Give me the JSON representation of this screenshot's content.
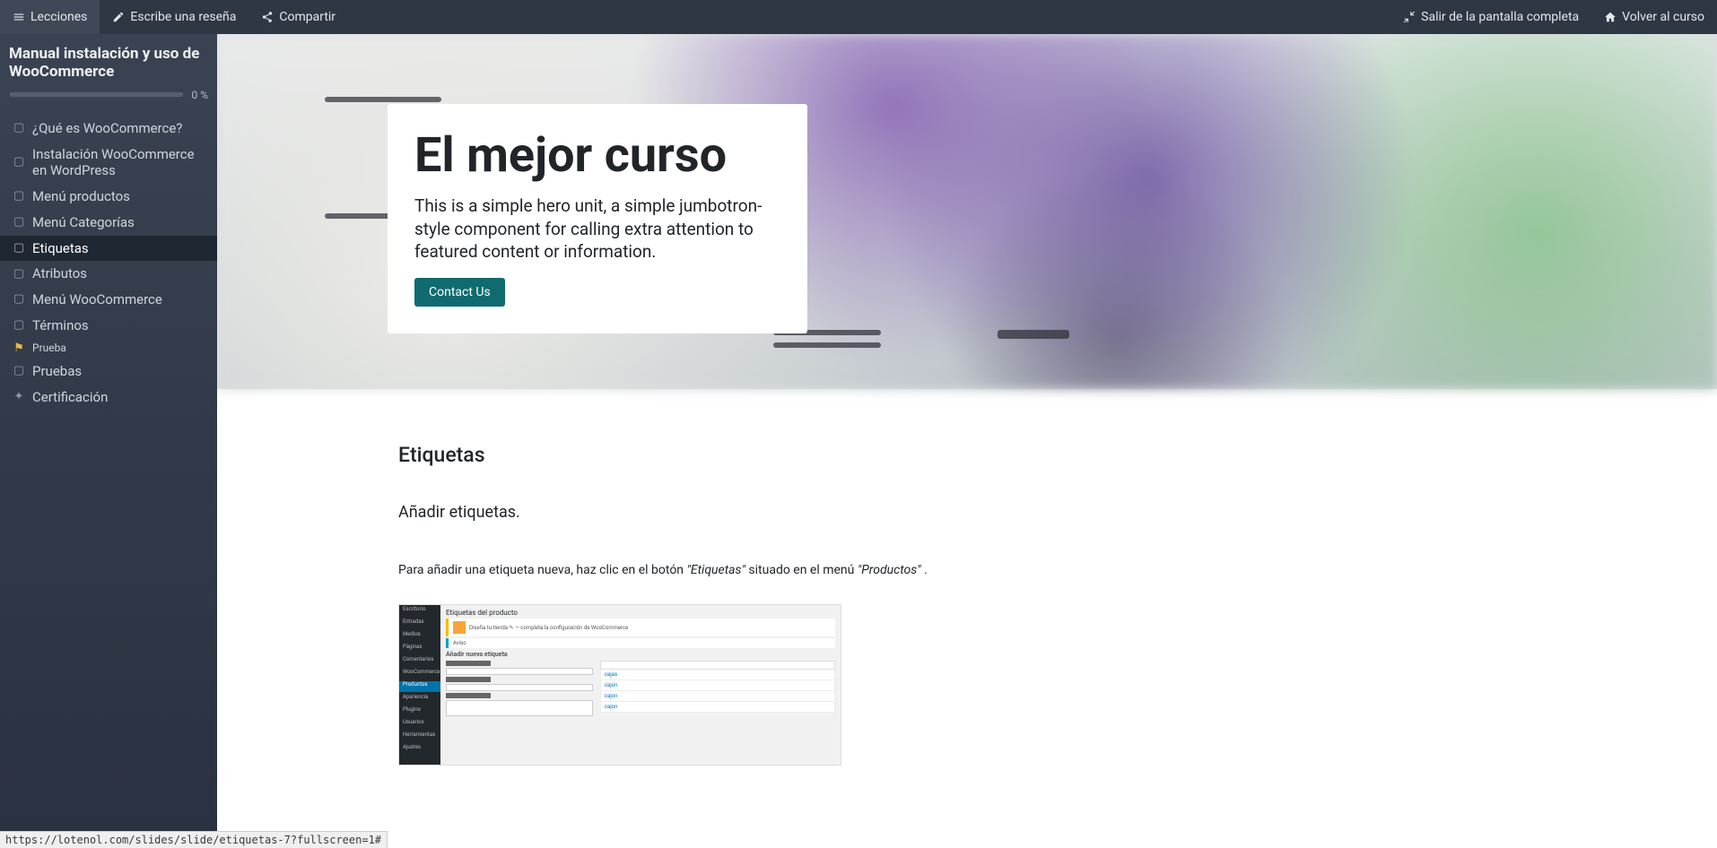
{
  "topnav": {
    "lessons": "Lecciones",
    "review": "Escribe una reseña",
    "share": "Compartir",
    "exit_fullscreen": "Salir de la pantalla completa",
    "back_to_course": "Volver al curso"
  },
  "sidebar": {
    "course_title": "Manual instalación y uso de WooCommerce",
    "progress_pct": "0 %",
    "items": [
      {
        "label": "¿Qué es WooCommerce?",
        "icon": "doc"
      },
      {
        "label": "Instalación WooCommerce en WordPress",
        "icon": "doc"
      },
      {
        "label": "Menú productos",
        "icon": "doc"
      },
      {
        "label": "Menú Categorías",
        "icon": "doc"
      },
      {
        "label": "Etiquetas",
        "icon": "doc",
        "active": true
      },
      {
        "label": "Atributos",
        "icon": "doc"
      },
      {
        "label": "Menú WooCommerce",
        "icon": "doc"
      },
      {
        "label": "Términos",
        "icon": "doc"
      },
      {
        "label": "Prueba",
        "icon": "flag",
        "small": true
      },
      {
        "label": "Pruebas",
        "icon": "doc"
      },
      {
        "label": "Certificación",
        "icon": "cert"
      }
    ]
  },
  "hero": {
    "title": "El mejor curso",
    "text": "This is a simple hero unit, a simple jumbotron-style component for calling extra attention to featured content or information.",
    "cta": "Contact Us"
  },
  "article": {
    "heading": "Etiquetas",
    "lead": "Añadir etiquetas.",
    "p1_a": "Para añadir una etiqueta nueva, haz clic en el botón ",
    "p1_em1": "\"Etiquetas\"",
    "p1_b": " situado en el menú ",
    "p1_em2": "\"Productos\"",
    "p1_c": " ."
  },
  "status_url": "https://lotenol.com/slides/slide/etiquetas-7?fullscreen=1#"
}
